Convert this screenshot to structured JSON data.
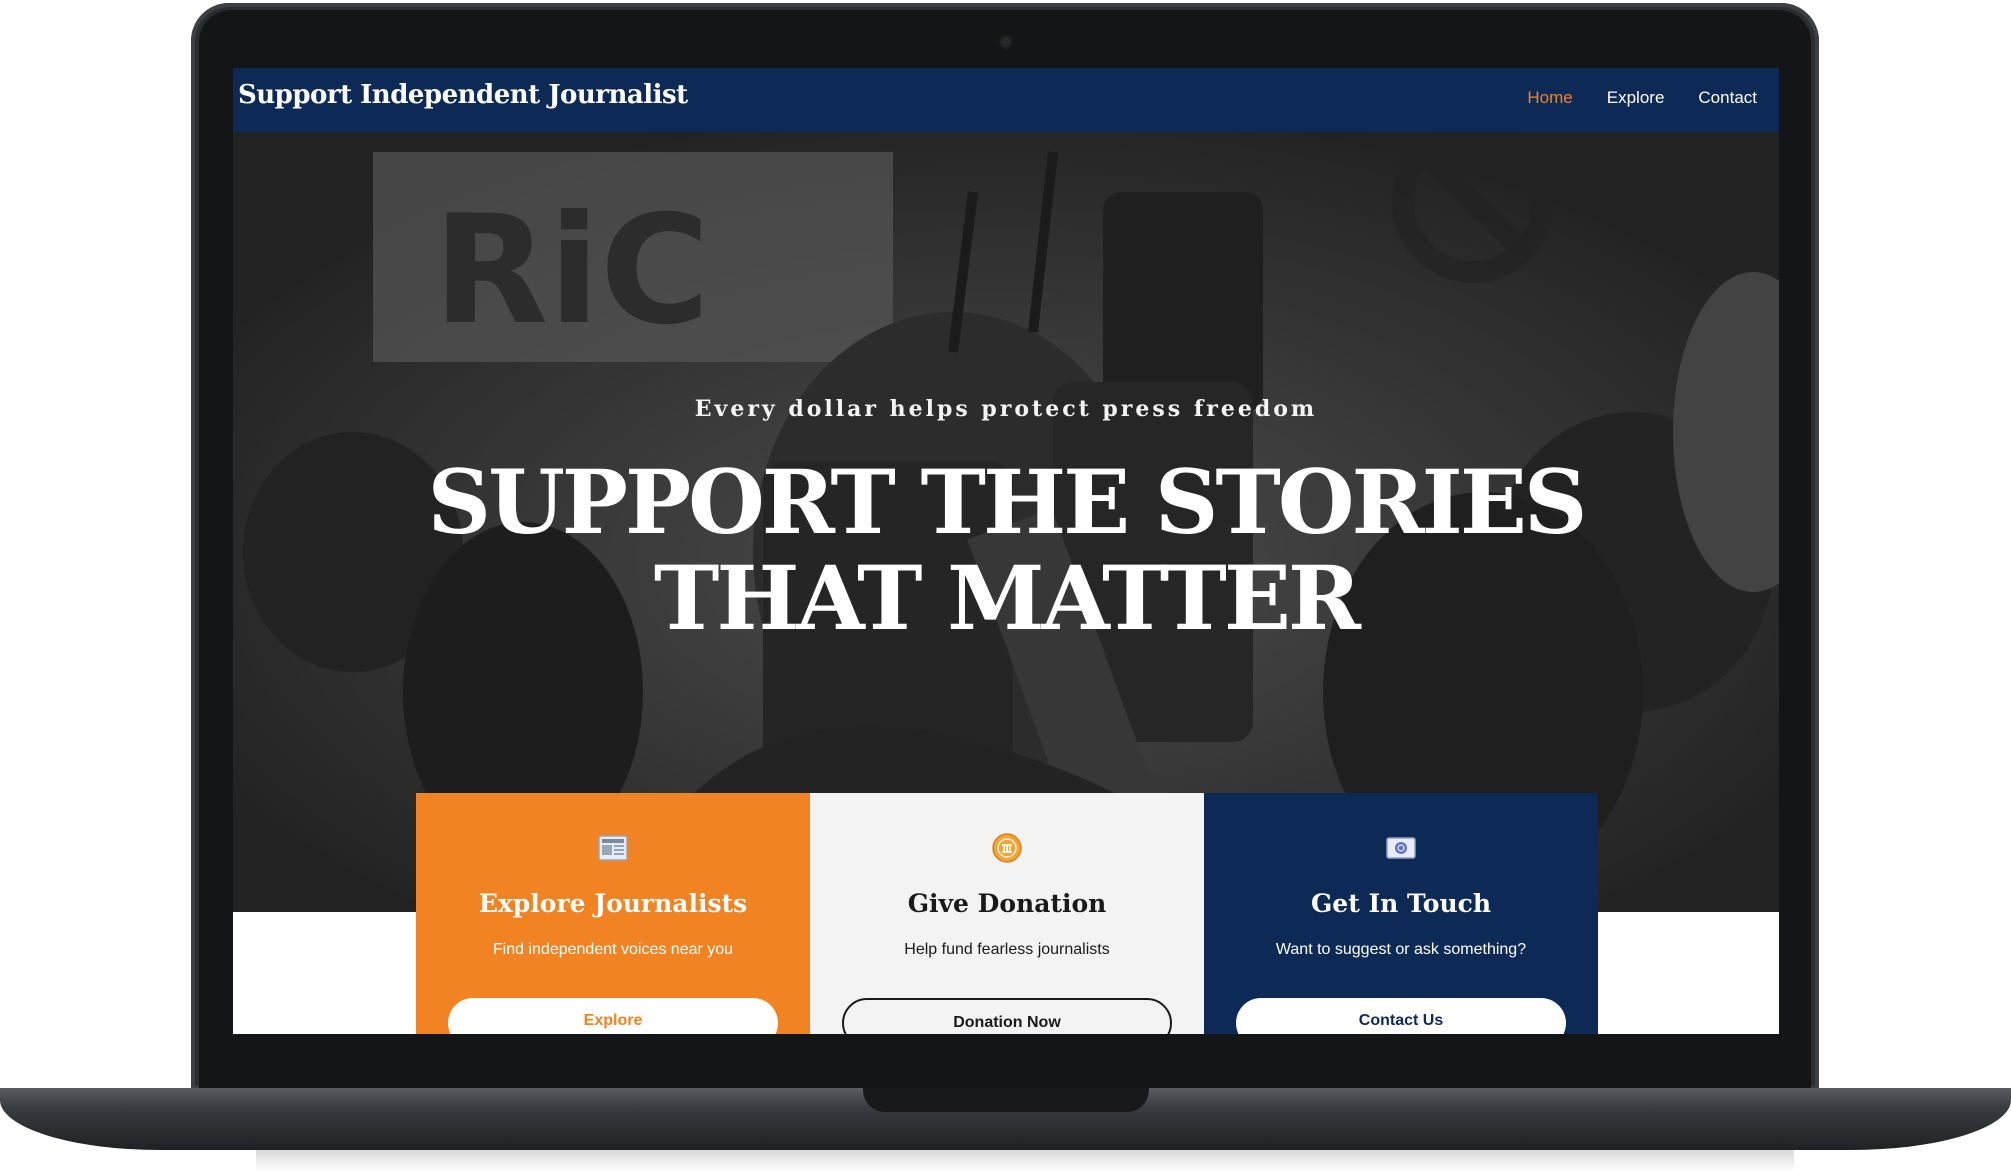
{
  "nav": {
    "brand": "Support Independent Journalist",
    "links": [
      {
        "label": "Home",
        "active": true
      },
      {
        "label": "Explore",
        "active": false
      },
      {
        "label": "Contact",
        "active": false
      }
    ]
  },
  "hero": {
    "kicker": "Every dollar helps protect press freedom",
    "title_line1": "SUPPORT THE STORIES",
    "title_line2": "THAT MATTER",
    "photo_icon": "photojournalist-crowd-photo"
  },
  "cards": [
    {
      "icon": "newspaper-icon",
      "title": "Explore Journalists",
      "subtitle": "Find independent voices near you",
      "button": "Explore",
      "color": "#f28322"
    },
    {
      "icon": "coin-icon",
      "title": "Give Donation",
      "subtitle": "Help fund fearless journalists",
      "button": "Donation Now",
      "color": "#f3f3f3"
    },
    {
      "icon": "contact-card-icon",
      "title": "Get In Touch",
      "subtitle": "Want to suggest or ask something?",
      "button": "Contact Us",
      "color": "#0d2a57"
    }
  ],
  "colors": {
    "accent": "#f28322",
    "navy": "#0d2a57",
    "light": "#f3f3f3"
  }
}
